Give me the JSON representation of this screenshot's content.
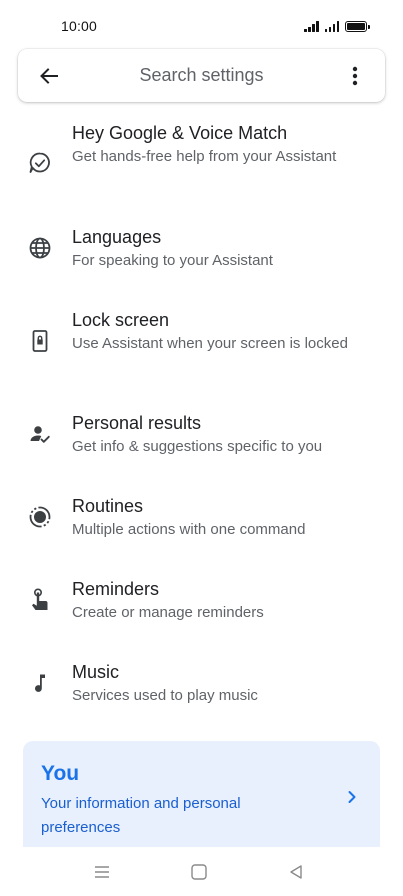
{
  "status_bar": {
    "time": "10:00",
    "icons": [
      "signal-icon",
      "signal-icon",
      "battery-icon"
    ]
  },
  "search": {
    "back_icon": "arrow-back-icon",
    "placeholder": "Search settings",
    "more_icon": "more-vert-icon"
  },
  "settings": [
    {
      "icon": "voice-match-icon",
      "title": "Hey Google & Voice Match",
      "subtitle": "Get hands-free help from your Assistant"
    },
    {
      "icon": "globe-icon",
      "title": "Languages",
      "subtitle": "For speaking to your Assistant"
    },
    {
      "icon": "lock-screen-icon",
      "title": "Lock screen",
      "subtitle": "Use Assistant when your screen is locked"
    },
    {
      "icon": "person-check-icon",
      "title": "Personal results",
      "subtitle": "Get info & suggestions specific to you"
    },
    {
      "icon": "routines-icon",
      "title": "Routines",
      "subtitle": "Multiple actions with one command"
    },
    {
      "icon": "reminder-icon",
      "title": "Reminders",
      "subtitle": "Create or manage reminders"
    },
    {
      "icon": "music-note-icon",
      "title": "Music",
      "subtitle": "Services used to play music"
    }
  ],
  "you_card": {
    "title": "You",
    "subtitle": "Your information and personal preferences",
    "chevron_icon": "chevron-right-icon"
  },
  "nav_bar": {
    "buttons": [
      "menu-icon",
      "home-icon",
      "back-icon"
    ]
  },
  "colors": {
    "accent": "#1a73e8",
    "card_bg": "#e8f0fe",
    "secondary_text": "#5f6368",
    "primary_text": "#202124"
  }
}
